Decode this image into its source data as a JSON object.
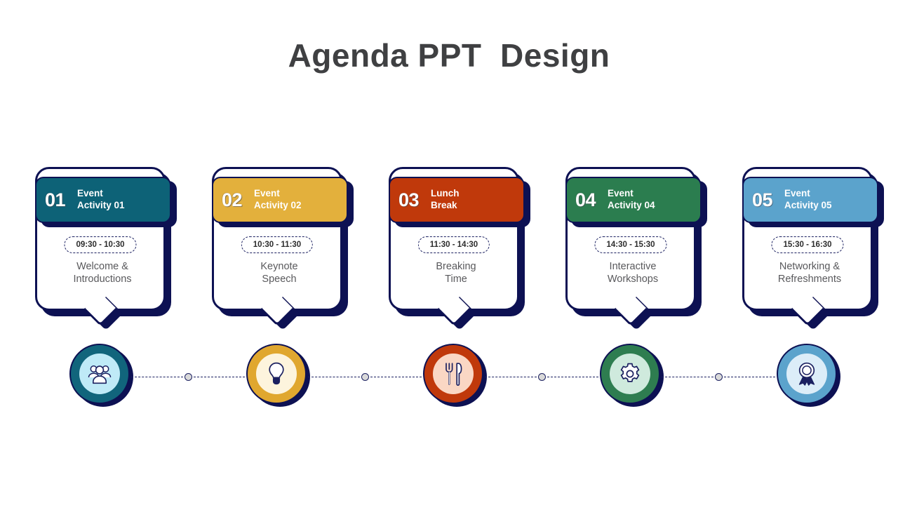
{
  "slide": {
    "title": "Agenda PPT  Design",
    "background": "#ffffff",
    "title_color": "#3f4042",
    "outline_color": "#0d1153"
  },
  "steps": [
    {
      "number": "01",
      "label": "Event\nActivity 01",
      "time": "09:30 - 10:30",
      "description": "Welcome &\nIntroductions",
      "icon": "people-group-icon",
      "chip_color": "#0d6277",
      "ring_color": "#11657c",
      "inner_color": "#bfeaf7"
    },
    {
      "number": "02",
      "label": "Event\nActivity 02",
      "time": "10:30 - 11:30",
      "description": "Keynote\nSpeech",
      "icon": "lightbulb-icon",
      "chip_color": "#e3b03c",
      "ring_color": "#e0a72f",
      "inner_color": "#fdf4dd"
    },
    {
      "number": "03",
      "label": "Lunch\nBreak",
      "time": "11:30 - 14:30",
      "description": "Breaking\nTime",
      "icon": "cutlery-icon",
      "chip_color": "#c0390b",
      "ring_color": "#c0390b",
      "inner_color": "#fad7c4"
    },
    {
      "number": "04",
      "label": "Event\nActivity 04",
      "time": "14:30 - 15:30",
      "description": "Interactive\nWorkshops",
      "icon": "gear-icon",
      "chip_color": "#2b7d4f",
      "ring_color": "#2e7d50",
      "inner_color": "#cfeadd"
    },
    {
      "number": "05",
      "label": "Event\nActivity 05",
      "time": "15:30 - 16:30",
      "description": "Networking &\nRefreshments",
      "icon": "award-ribbon-icon",
      "chip_color": "#5ba3cc",
      "ring_color": "#5ba3cc",
      "inner_color": "#dcedf8"
    }
  ],
  "connectors": {
    "count": 4,
    "dot_color": "#d9d9d9",
    "line_color": "#1b2060",
    "style": "dashed"
  }
}
